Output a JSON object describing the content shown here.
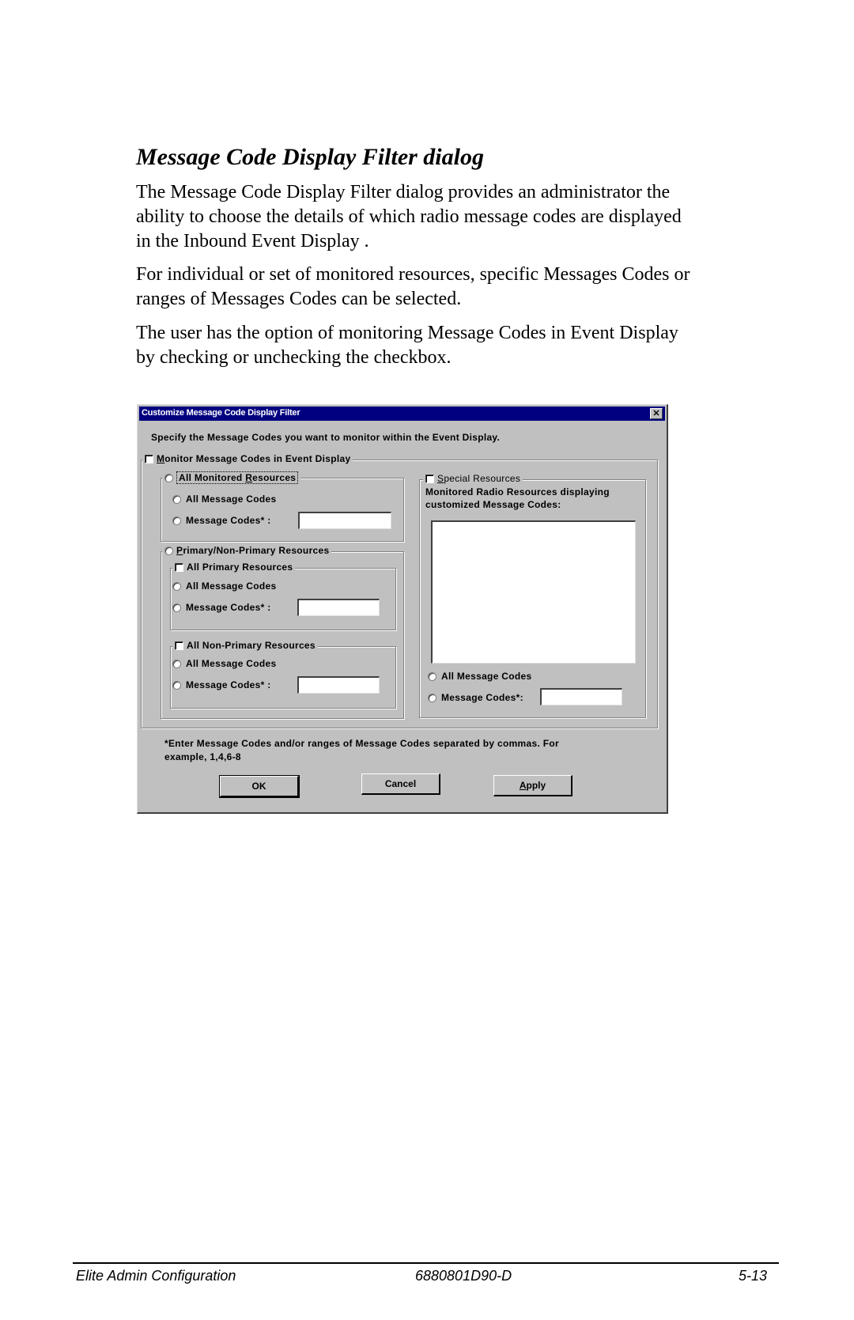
{
  "document": {
    "heading": "Message Code Display Filter dialog",
    "paragraphs": [
      [
        "The Message Code Display Filter dialog provides an administrator the",
        "ability to choose the details of which radio message codes are displayed",
        "in the Inbound Event Display ."
      ],
      [
        "For individual or set of monitored resources, specific Messages Codes or",
        "ranges of Messages Codes can be selected."
      ],
      [
        "The user has the option of monitoring Message Codes in Event Display",
        "by checking or unchecking the checkbox."
      ]
    ],
    "footer": {
      "left": "Elite Admin Configuration",
      "center": "6880801D90-D",
      "right": "5-13"
    }
  },
  "dialog": {
    "title": "Customize Message Code Display Filter",
    "close_icon": "close-x-icon",
    "instruction": "Specify the Message Codes you want to monitor within the Event Display.",
    "monitor_checkbox": {
      "label_accel": "M",
      "label_rest": "onitor Message Codes in Event Display",
      "checked": false
    },
    "all_monitored": {
      "label_pre": "All Monitored ",
      "label_accel": "R",
      "label_post": "esources",
      "selected": false,
      "all_codes_label": "All Message Codes",
      "codes_label": "Message Codes* :",
      "codes_value": ""
    },
    "primary_non_primary": {
      "label_accel": "P",
      "label_rest": "rimary/Non-Primary Resources",
      "selected": false,
      "primary": {
        "label": "All Primary Resources",
        "checked": false,
        "all_codes_label": "All Message Codes",
        "codes_label": "Message Codes* :",
        "codes_value": ""
      },
      "non_primary": {
        "label": "All Non-Primary Resources",
        "checked": false,
        "all_codes_label": "All Message Codes",
        "codes_label": "Message Codes* :",
        "codes_value": ""
      }
    },
    "special": {
      "label_accel": "S",
      "label_rest": "pecial Resources",
      "checked": false,
      "description_line1": "Monitored Radio Resources displaying",
      "description_line2": "customized Message Codes:",
      "list_items": [],
      "all_codes_label": "All Message Codes",
      "codes_label": "Message Codes*:",
      "codes_value": ""
    },
    "note_line1": "*Enter Message Codes and/or ranges of Message Codes separated by commas. For",
    "note_line2": "example, 1,4,6-8",
    "buttons": {
      "ok": "OK",
      "cancel": "Cancel",
      "apply_accel": "A",
      "apply_rest": "pply"
    }
  }
}
